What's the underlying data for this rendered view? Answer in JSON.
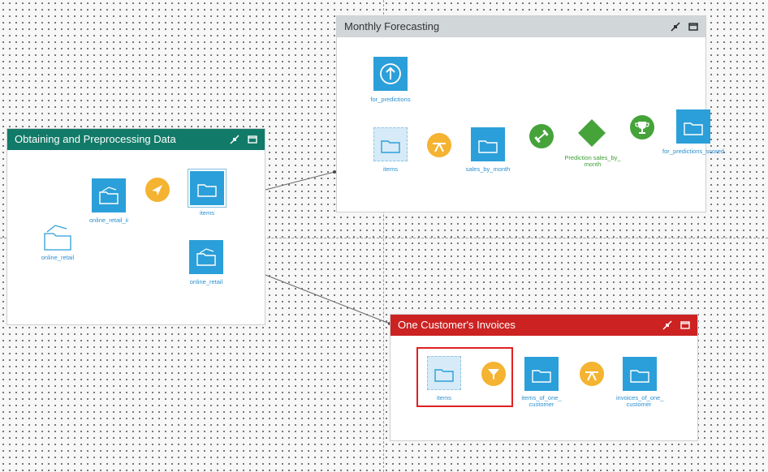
{
  "zones": {
    "preprocessing": {
      "title": "Obtaining and Preprocessing Data",
      "color": "#117a68"
    },
    "forecasting": {
      "title": "Monthly Forecasting",
      "color": "#d1d6d8"
    },
    "invoices": {
      "title": "One Customer's Invoices",
      "color": "#cc2222"
    }
  },
  "nodes": {
    "online_retail_ii": "online_retail_ii",
    "items_pre": "items",
    "online_retail_src": "online_retail",
    "online_retail_out": "online_retail",
    "for_predictions": "for_predictions",
    "items_fc": "items",
    "sales_by_month": "sales_by_month",
    "prediction_line1": "Prediction sales_by_",
    "prediction_line2": "month",
    "for_predictions_scored": "for_predictions_scored",
    "items_inv": "items",
    "items_of_one_line1": "items_of_one_",
    "items_of_one_line2": "customer",
    "invoices_of_one_line1": "invoices_of_one_",
    "invoices_of_one_line2": "customer"
  },
  "colors": {
    "dataset": "#2b9fd9",
    "recipe_orange": "#f4b331",
    "ml_green": "#45a33a",
    "highlight": "#e02020"
  },
  "icons": [
    "folder-icon",
    "upload-icon",
    "arrow-icon",
    "filter-icon",
    "split-icon",
    "dumbbell-icon",
    "trophy-icon",
    "minimize-icon",
    "maximize-icon"
  ]
}
